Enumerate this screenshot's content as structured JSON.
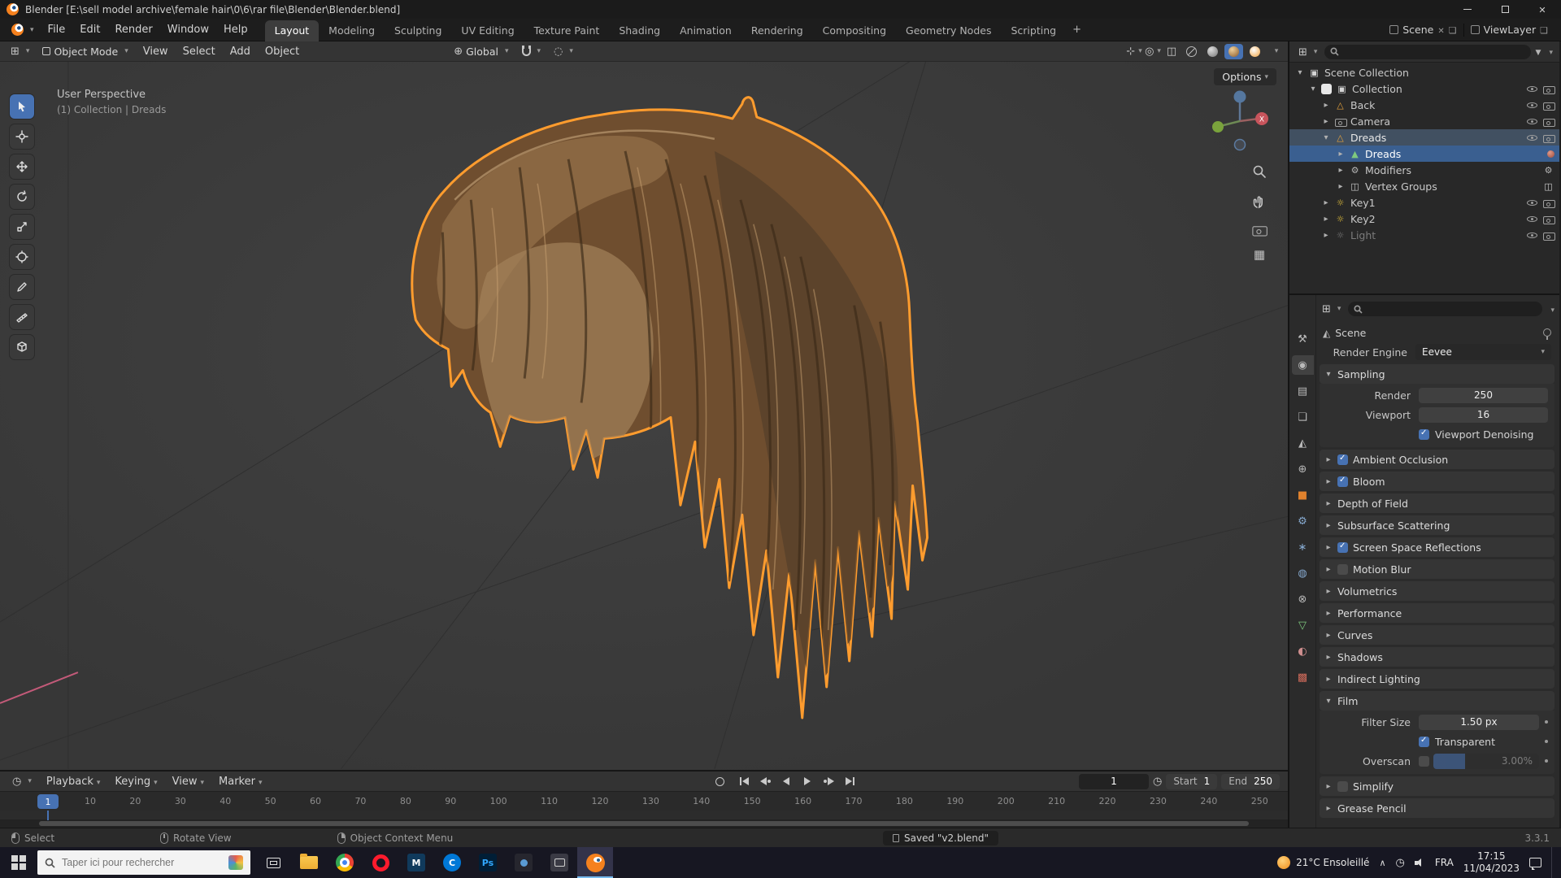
{
  "titlebar": {
    "title": "Blender [E:\\sell model archive\\female hair\\0\\6\\rar file\\Blender\\Blender.blend]"
  },
  "topbar": {
    "menus": [
      "File",
      "Edit",
      "Render",
      "Window",
      "Help"
    ],
    "workspaces": [
      {
        "label": "Layout",
        "cls": "active"
      },
      {
        "label": "Modeling"
      },
      {
        "label": "Sculpting"
      },
      {
        "label": "UV Editing"
      },
      {
        "label": "Texture Paint"
      },
      {
        "label": "Shading"
      },
      {
        "label": "Animation"
      },
      {
        "label": "Rendering"
      },
      {
        "label": "Compositing"
      },
      {
        "label": "Geometry Nodes"
      },
      {
        "label": "Scripting"
      }
    ],
    "add_workspace": "+",
    "scene_label": "Scene",
    "viewlayer_label": "ViewLayer"
  },
  "viewport": {
    "mode": "Object Mode",
    "menus": [
      "View",
      "Select",
      "Add",
      "Object"
    ],
    "orientation": "Global",
    "options_label": "Options",
    "overlay": {
      "line1": "User Perspective",
      "line2": "(1) Collection | Dreads"
    },
    "axis_x": "X"
  },
  "outliner": {
    "rows": [
      {
        "label": "Scene Collection"
      },
      {
        "label": "Collection"
      },
      {
        "label": "Back"
      },
      {
        "label": "Camera"
      },
      {
        "label": "Dreads"
      },
      {
        "label": "Dreads"
      },
      {
        "label": "Modifiers"
      },
      {
        "label": "Vertex Groups"
      },
      {
        "label": "Key1"
      },
      {
        "label": "Key2"
      },
      {
        "label": "Light"
      }
    ]
  },
  "properties": {
    "breadcrumb": "Scene",
    "render_engine_label": "Render Engine",
    "render_engine": "Eevee",
    "sampling_title": "Sampling",
    "render_label": "Render",
    "render_value": "250",
    "viewport_label": "Viewport",
    "viewport_value": "16",
    "denoise_label": "Viewport Denoising",
    "sections": {
      "ao": "Ambient Occlusion",
      "bloom": "Bloom",
      "dof": "Depth of Field",
      "sss": "Subsurface Scattering",
      "ssr": "Screen Space Reflections",
      "mb": "Motion Blur",
      "vol": "Volumetrics",
      "perf": "Performance",
      "curves": "Curves",
      "shadows": "Shadows",
      "indirect": "Indirect Lighting",
      "film": "Film",
      "simplify": "Simplify",
      "gp": "Grease Pencil"
    },
    "film": {
      "filter_label": "Filter Size",
      "filter_value": "1.50 px",
      "transparent_label": "Transparent",
      "overscan_label": "Overscan",
      "overscan_value": "3.00%"
    },
    "tabs": [
      {
        "glyph": "⚒",
        "cls": "cg",
        "name": "tool"
      },
      {
        "glyph": "◉",
        "cls": "cg active",
        "name": "render"
      },
      {
        "glyph": "▤",
        "cls": "cg",
        "name": "output"
      },
      {
        "glyph": "❏",
        "cls": "cg",
        "name": "view-layer"
      },
      {
        "glyph": "◭",
        "cls": "cg",
        "name": "scene"
      },
      {
        "glyph": "⊕",
        "cls": "cg",
        "name": "world"
      },
      {
        "glyph": "■",
        "cls": "c-or",
        "name": "object"
      },
      {
        "glyph": "⚙",
        "cls": "c-bl",
        "name": "modifiers"
      },
      {
        "glyph": "∗",
        "cls": "c-bl",
        "name": "particles"
      },
      {
        "glyph": "◍",
        "cls": "c-bl",
        "name": "physics"
      },
      {
        "glyph": "⊗",
        "cls": "cg",
        "name": "constraints"
      },
      {
        "glyph": "▽",
        "cls": "c-gr",
        "name": "object-data"
      },
      {
        "glyph": "◐",
        "cls": "c-pk",
        "name": "material"
      },
      {
        "glyph": "▩",
        "cls": "c-rd",
        "name": "texture"
      }
    ]
  },
  "timeline": {
    "menus": [
      "Playback",
      "Keying",
      "View",
      "Marker"
    ],
    "frame": "1",
    "start_label": "Start",
    "start_value": "1",
    "end_label": "End",
    "end_value": "250",
    "ticks": [
      "10",
      "20",
      "30",
      "40",
      "50",
      "60",
      "70",
      "80",
      "90",
      "100",
      "110",
      "120",
      "130",
      "140",
      "150",
      "160",
      "170",
      "180",
      "190",
      "200",
      "210",
      "220",
      "230",
      "240",
      "250"
    ]
  },
  "statusbar": {
    "hints": [
      {
        "label": "Select",
        "cls": "lmb"
      },
      {
        "label": "Rotate View",
        "cls": "mmb"
      },
      {
        "label": "Object Context Menu",
        "cls": "rmb"
      }
    ],
    "saved": "Saved \"v2.blend\"",
    "version": "3.3.1"
  },
  "taskbar": {
    "search_placeholder": "Taper ici pour rechercher",
    "app_m": "M",
    "app_c": "C",
    "ps": "Ps",
    "weather": "21°C Ensoleillé",
    "lang": "FRA",
    "time": "17:15",
    "date": "11/04/2023"
  }
}
